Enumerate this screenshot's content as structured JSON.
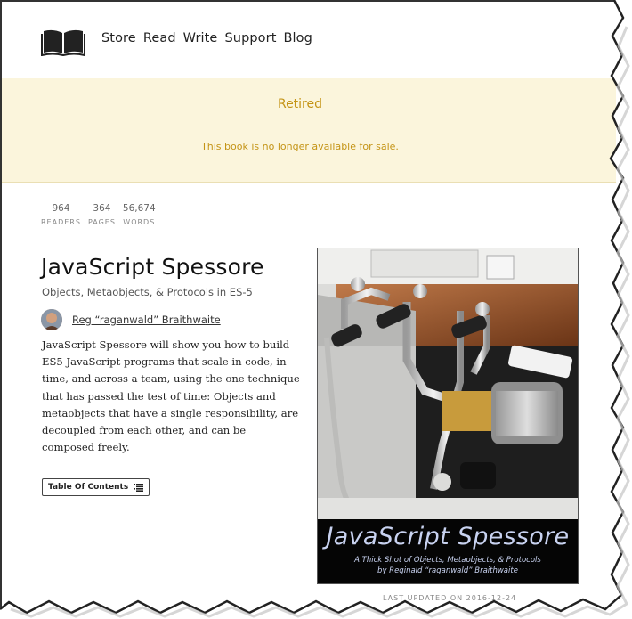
{
  "header": {
    "logo_icon": "open-book-icon",
    "nav": [
      {
        "label": "Store"
      },
      {
        "label": "Read"
      },
      {
        "label": "Write"
      },
      {
        "label": "Support"
      },
      {
        "label": "Blog"
      }
    ]
  },
  "banner": {
    "title": "Retired",
    "message": "This book is no longer available for sale.",
    "background": "#fbf5dc",
    "text_color": "#c49416"
  },
  "stats": [
    {
      "value": "964",
      "label": "READERS"
    },
    {
      "value": "364",
      "label": "PAGES"
    },
    {
      "value": "56,674",
      "label": "WORDS"
    }
  ],
  "book": {
    "title": "JavaScript Spessore",
    "subtitle": "Objects, Metaobjects, & Protocols in ES-5",
    "author": "Reg “raganwald” Braithwaite",
    "description": "JavaScript Spessore will show you how to build ES5 JavaScript programs that scale in code, in time, and across a team, using the one technique that has passed the test of time: Objects and metaobjects that have a single responsibility, are decoupled from each other, and can be composed freely.",
    "toc_label": "Table Of Contents",
    "toc_icon": "list-icon",
    "last_updated": "LAST UPDATED ON 2016-12-24"
  },
  "cover": {
    "title": "JavaScript Spessore",
    "tagline": "A Thick Shot of Objects, Metaobjects, & Protocols",
    "byline": "by Reginald “raganwald” Braithwaite",
    "image": "espresso-machine-photo"
  }
}
